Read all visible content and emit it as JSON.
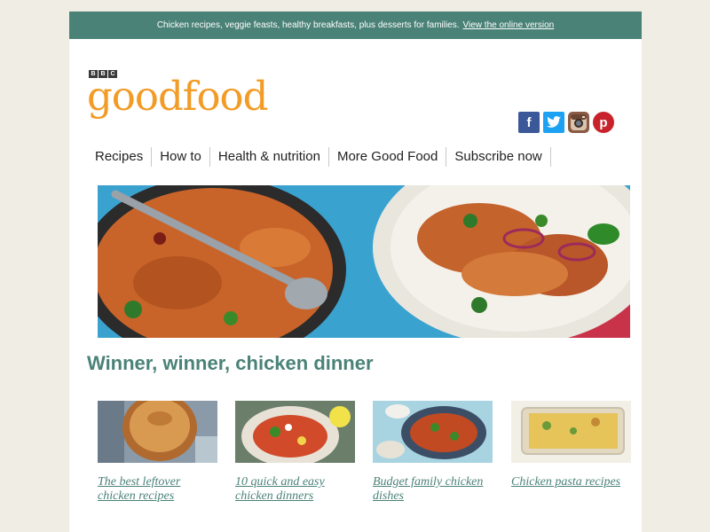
{
  "topbar": {
    "text": "Chicken recipes, veggie feasts, healthy breakfasts, plus desserts for families.",
    "link": "View the online version"
  },
  "logo": {
    "bbc_letters": [
      "B",
      "B",
      "C"
    ],
    "word": "goodfood"
  },
  "social": [
    {
      "name": "facebook-icon",
      "glyph": "f"
    },
    {
      "name": "twitter-icon",
      "glyph": ""
    },
    {
      "name": "instagram-icon",
      "glyph": ""
    },
    {
      "name": "pinterest-icon",
      "glyph": "p"
    }
  ],
  "nav": [
    "Recipes",
    "How to",
    "Health & nutrition",
    "More Good Food",
    "Subscribe now"
  ],
  "headline": "Winner, winner, chicken dinner",
  "cards": [
    {
      "label": "The best leftover chicken recipes"
    },
    {
      "label": "10 quick and easy chicken dinners"
    },
    {
      "label": "Budget family chicken dishes"
    },
    {
      "label": "Chicken pasta recipes"
    }
  ],
  "colors": {
    "accent": "#4a8277",
    "logo": "#f29b26",
    "background": "#efede4"
  }
}
